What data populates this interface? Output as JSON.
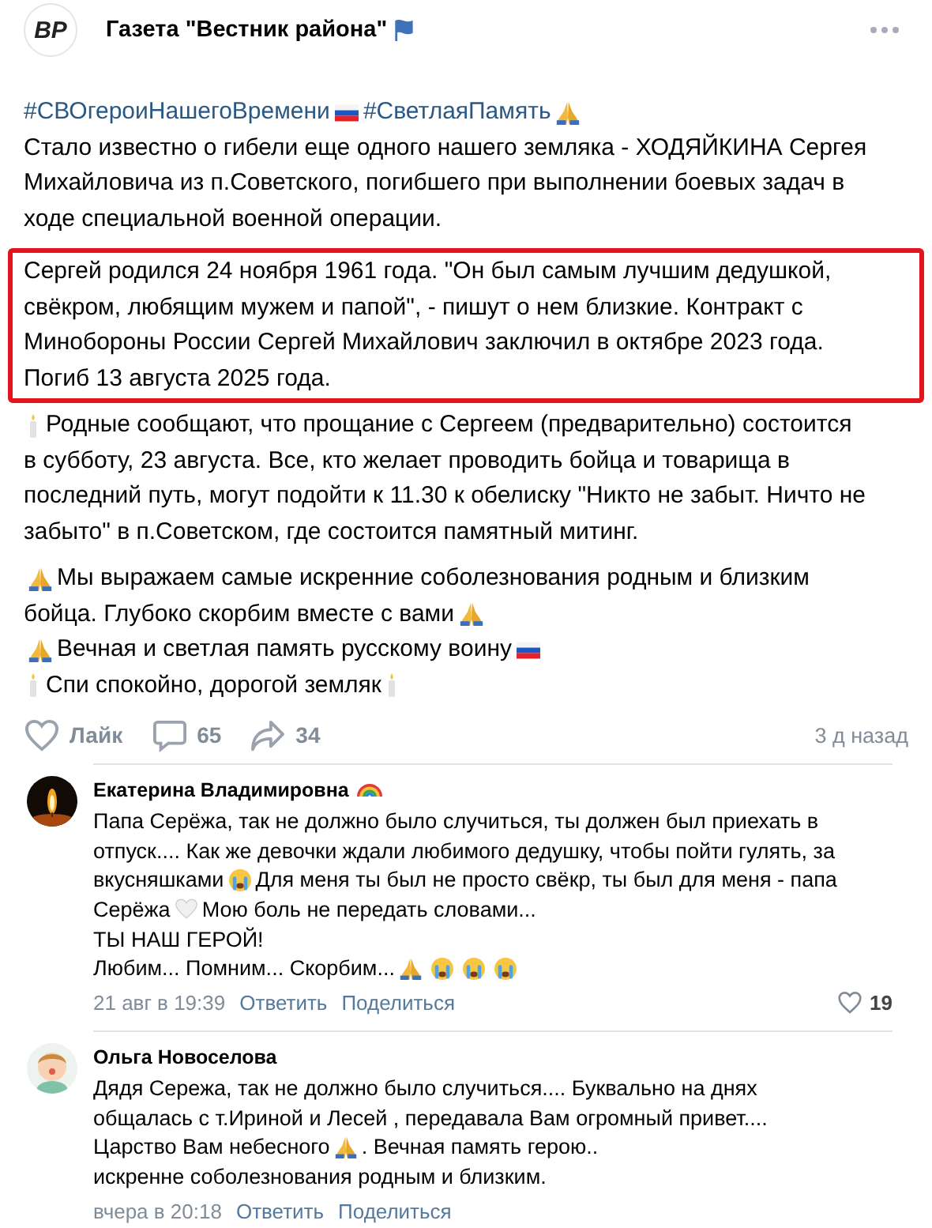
{
  "header": {
    "logo_text": "ВР",
    "title": "Газета \"Вестник района\""
  },
  "paragraphs": [
    {
      "highlighted": false,
      "lines": [
        [
          {
            "kind": "hashtag",
            "text": "#СВОгероиНашегоВремени"
          },
          {
            "kind": "flag"
          },
          {
            "kind": "hashtag",
            "text": "#СветлаяПамять"
          },
          {
            "kind": "pray"
          }
        ],
        [
          {
            "kind": "text",
            "text": "Стало известно о гибели еще одного нашего земляка - ХОДЯЙКИНА Сергея"
          }
        ],
        [
          {
            "kind": "text",
            "text": "Михайловича из п.Советского, погибшего при выполнении боевых задач в"
          }
        ],
        [
          {
            "kind": "text",
            "text": "ходе специальной военной операции."
          }
        ]
      ]
    },
    {
      "highlighted": true,
      "lines": [
        [
          {
            "kind": "text",
            "text": "Сергей родился 24 ноября 1961 года. \"Он был самым лучшим дедушкой,"
          }
        ],
        [
          {
            "kind": "text",
            "text": "свёкром, любящим мужем и папой\", - пишут о нем близкие. Контракт с"
          }
        ],
        [
          {
            "kind": "text",
            "text": "Минобороны России Сергей Михайлович заключил в октябре 2023 года."
          }
        ],
        [
          {
            "kind": "text",
            "text": "Погиб 13 августа 2025 года."
          }
        ]
      ]
    },
    {
      "highlighted": false,
      "lines": [
        [
          {
            "kind": "candle"
          },
          {
            "kind": "text",
            "text": "Родные сообщают, что прощание с Сергеем (предварительно) состоится"
          }
        ],
        [
          {
            "kind": "text",
            "text": "в субботу, 23 августа. Все, кто желает проводить бойца и товарища в"
          }
        ],
        [
          {
            "kind": "text",
            "text": "последний путь, могут подойти к 11.30 к обелиску \"Никто не забыт. Ничто не"
          }
        ],
        [
          {
            "kind": "text",
            "text": "забыто\" в п.Советском, где состоится памятный митинг."
          }
        ]
      ]
    },
    {
      "highlighted": false,
      "lines": [
        [
          {
            "kind": "pray"
          },
          {
            "kind": "text",
            "text": "Мы выражаем самые искренние соболезнования родным и близким"
          }
        ],
        [
          {
            "kind": "text",
            "text": "бойца. Глубоко скорбим вместе с вами"
          },
          {
            "kind": "pray"
          }
        ],
        [
          {
            "kind": "pray"
          },
          {
            "kind": "text",
            "text": "Вечная и светлая память русскому воину"
          },
          {
            "kind": "flag"
          }
        ],
        [
          {
            "kind": "candle"
          },
          {
            "kind": "text",
            "text": "Спи спокойно, дорогой земляк"
          },
          {
            "kind": "candle"
          }
        ]
      ]
    }
  ],
  "actions": {
    "like": "Лайк",
    "comments": "65",
    "shares": "34",
    "time": "3 д назад"
  },
  "comments": [
    {
      "avatar": {
        "kind": "picture"
      },
      "name": "Екатерина Владимировна",
      "name_icons": [
        {
          "kind": "rainbow"
        }
      ],
      "lines": [
        [
          {
            "kind": "text",
            "text": "Папа Серёжа, так не должно было случиться, ты должен был приехать в"
          }
        ],
        [
          {
            "kind": "text",
            "text": "отпуск.... Как же девочки ждали любимого дедушку, чтобы пойти гулять, за"
          }
        ],
        [
          {
            "kind": "text",
            "text": "вкусняшками"
          },
          {
            "kind": "cry"
          },
          {
            "kind": "text",
            "text": "Для меня ты был не просто свёкр, ты был для меня - папа"
          }
        ],
        [
          {
            "kind": "text",
            "text": "Серёжа"
          },
          {
            "kind": "heart"
          },
          {
            "kind": "text",
            "text": "Мою боль не передать словами..."
          }
        ],
        [
          {
            "kind": "text",
            "text": "ТЫ НАШ ГЕРОЙ!"
          }
        ],
        [
          {
            "kind": "text",
            "text": "Любим... Помним... Скорбим..."
          },
          {
            "kind": "pray"
          },
          {
            "kind": "cry"
          },
          {
            "kind": "cry"
          },
          {
            "kind": "cry"
          }
        ]
      ],
      "time": "21 авг в 19:39",
      "reply": "Ответить",
      "share": "Поделиться",
      "likes": "19"
    },
    {
      "avatar": {
        "kind": "picture"
      },
      "name": "Ольга Новоселова",
      "lines": [
        [
          {
            "kind": "text",
            "text": "Дядя Сережа, так не должно было случиться.... Буквально на днях"
          }
        ],
        [
          {
            "kind": "text",
            "text": "общалась с т.Ириной и Лесей , передавала Вам огромный привет...."
          }
        ],
        [
          {
            "kind": "text",
            "text": "Царство Вам небесного"
          },
          {
            "kind": "pray"
          },
          {
            "kind": "text",
            "text": ". Вечная память герою.."
          }
        ],
        [
          {
            "kind": "text",
            "text": "искренне соболезнования родным и близким."
          }
        ]
      ],
      "time": "вчера в 20:18",
      "reply": "Ответить",
      "share": "Поделиться"
    }
  ]
}
